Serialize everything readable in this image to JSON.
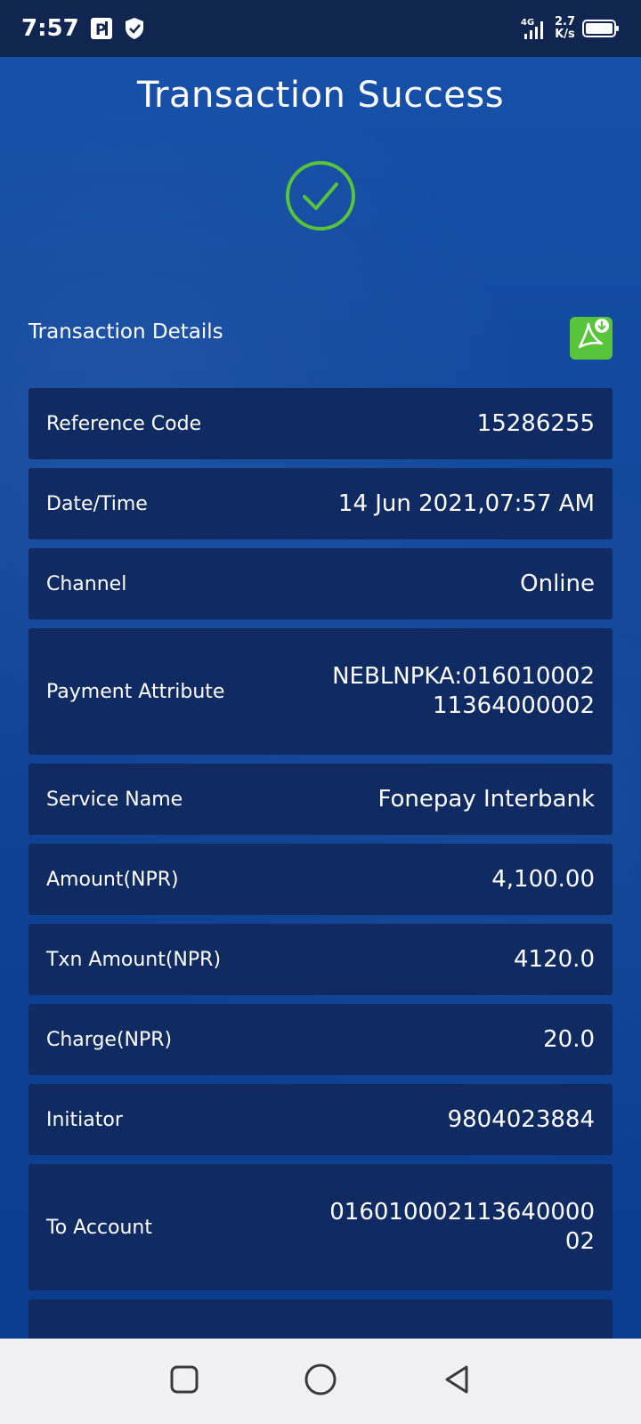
{
  "status_bar": {
    "time": "7:57",
    "network": "4G",
    "speed_value": "2.7",
    "speed_unit": "K/s",
    "icons": [
      "parking-icon",
      "shield-check-icon",
      "signal-icon",
      "battery-icon"
    ]
  },
  "header": {
    "title": "Transaction Success"
  },
  "details": {
    "heading": "Transaction Details",
    "pdf_icon": "pdf-download-icon",
    "rows": [
      {
        "label": "Reference Code",
        "value": "15286255"
      },
      {
        "label": "Date/Time",
        "value": "14 Jun 2021,07:57 AM"
      },
      {
        "label": "Channel",
        "value": "Online"
      },
      {
        "label": "Payment Attribute",
        "value": "NEBLNPKA:01601000211364000002"
      },
      {
        "label": "Service Name",
        "value": "Fonepay Interbank"
      },
      {
        "label": "Amount(NPR)",
        "value": "4,100.00"
      },
      {
        "label": "Txn Amount(NPR)",
        "value": "4120.0"
      },
      {
        "label": "Charge(NPR)",
        "value": "20.0"
      },
      {
        "label": "Initiator",
        "value": "9804023884"
      },
      {
        "label": "To Account",
        "value": "01601000211364000002"
      }
    ]
  },
  "nav_bar": {
    "icons": [
      "recents-square-icon",
      "home-circle-icon",
      "back-triangle-icon"
    ]
  },
  "colors": {
    "background": "#0f4396",
    "row": "#0f2b62",
    "success_green": "#58c43a",
    "status_bar": "#10254f",
    "nav_bar": "#f1f0f4"
  }
}
